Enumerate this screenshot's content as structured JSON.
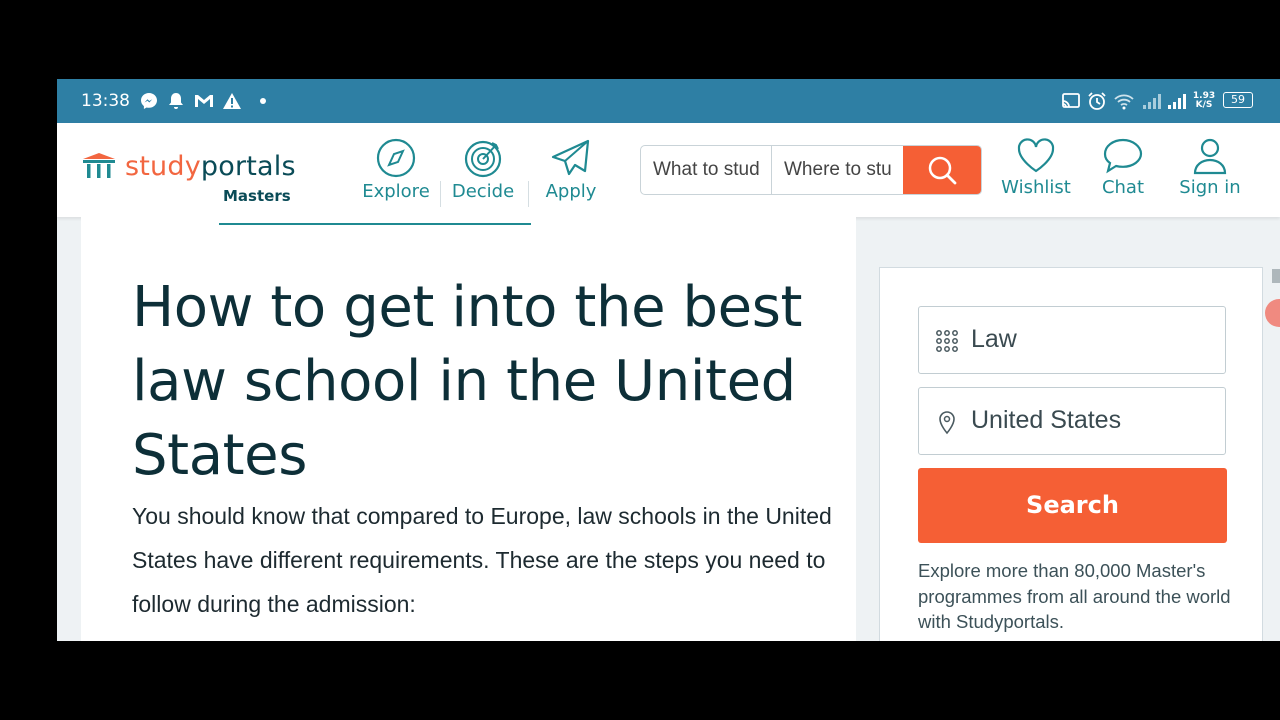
{
  "status_bar": {
    "time": "13:38",
    "network_speed_value": "1.93",
    "network_speed_unit": "K/S",
    "battery": "59",
    "left_icons": [
      "messenger-icon",
      "notification-bell-icon",
      "gmail-icon",
      "warning-icon",
      "dot-icon"
    ],
    "right_icons": [
      "cast-icon",
      "alarm-icon",
      "wifi-icon",
      "signal-icon",
      "signal-icon-2",
      "battery-icon"
    ]
  },
  "nav": {
    "logo_part1": "study",
    "logo_part2": "portals",
    "logo_sub": "Masters",
    "items": [
      {
        "label": "Explore",
        "icon": "compass-icon"
      },
      {
        "label": "Decide",
        "icon": "target-icon"
      },
      {
        "label": "Apply",
        "icon": "paper-plane-icon"
      }
    ],
    "search_what_placeholder": "What to study?",
    "search_where_placeholder": "Where to study?",
    "right_items": [
      {
        "label": "Wishlist",
        "icon": "heart-icon"
      },
      {
        "label": "Chat",
        "icon": "chat-bubble-icon"
      },
      {
        "label": "Sign in",
        "icon": "user-icon"
      }
    ]
  },
  "article": {
    "title": "How to get into the best law school in the United States",
    "lead": "You should know that compared to Europe, law schools in the United States have different requirements. These are the steps you need to follow during the admission:"
  },
  "sidebar": {
    "discipline_value": "Law",
    "location_value": "United States",
    "search_label": "Search",
    "explore_text": "Explore more than 80,000 Master's programmes from all around the world with Studyportals."
  },
  "colors": {
    "status_bar": "#2e7fa4",
    "accent": "#f55f35",
    "teal": "#1f8a92",
    "dark": "#0d2f38"
  }
}
